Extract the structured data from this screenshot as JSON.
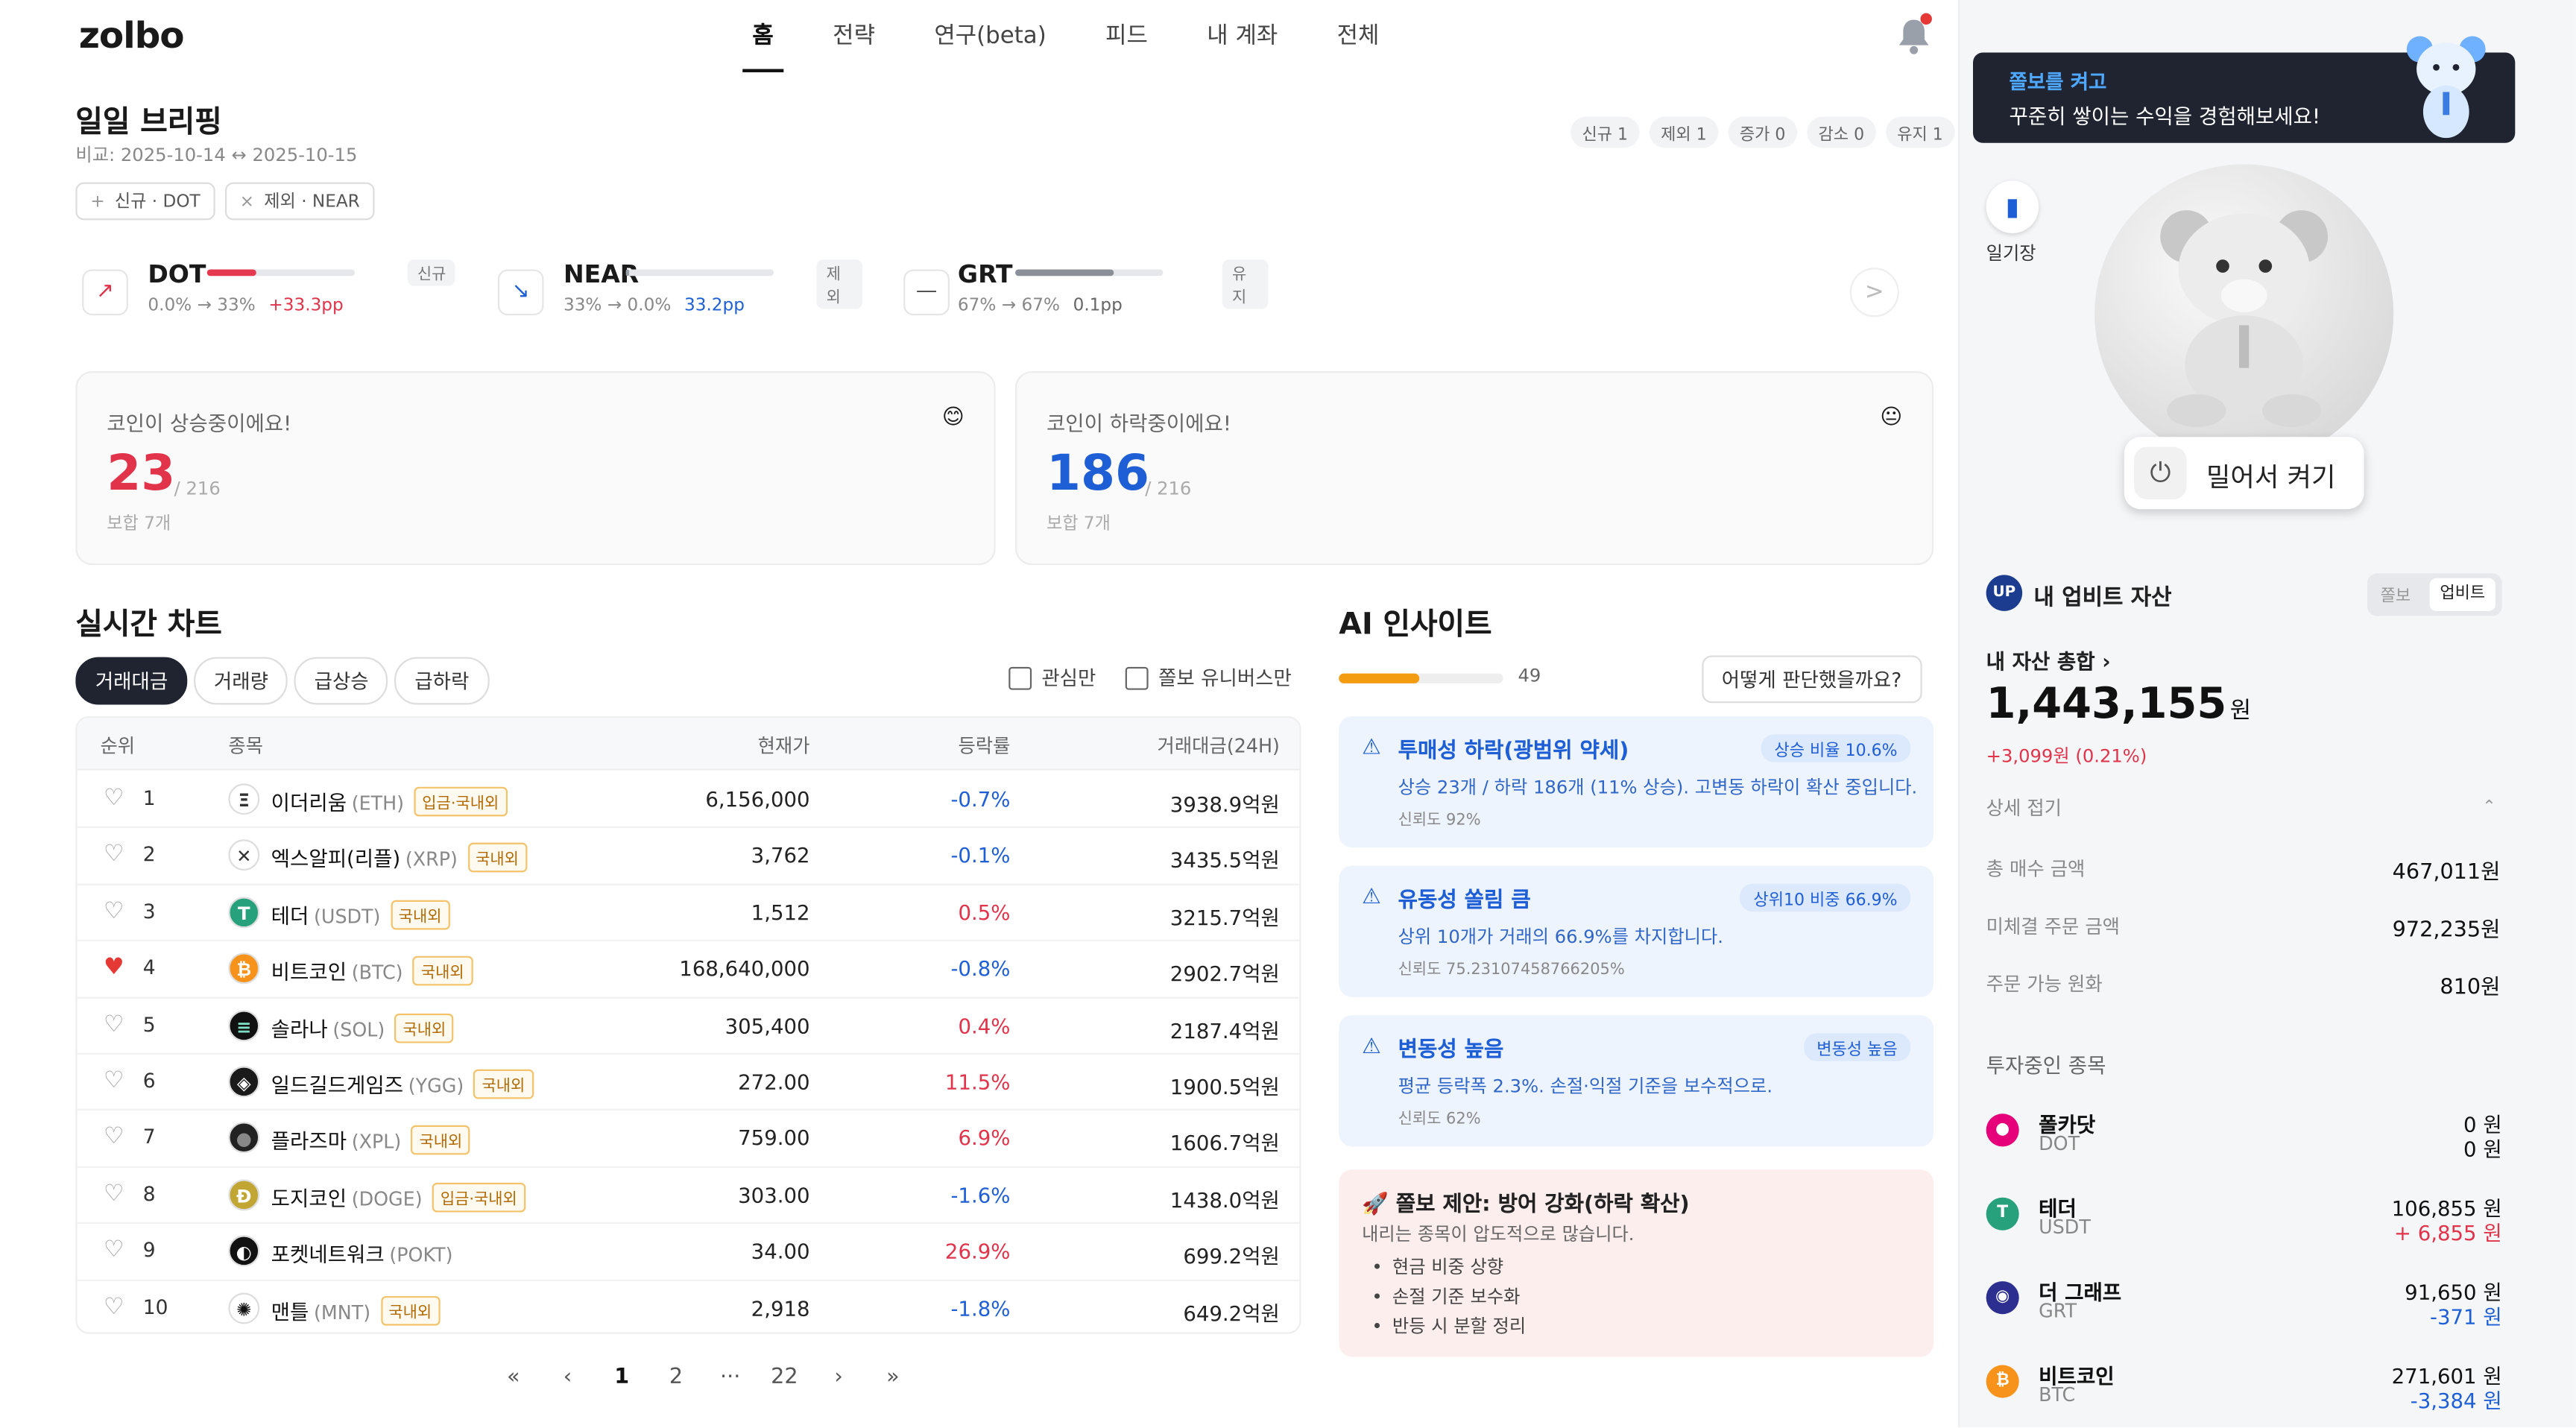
{
  "nav": {
    "logo": "zolbo",
    "items": [
      "홈",
      "전략",
      "연구(beta)",
      "피드",
      "내 계좌",
      "전체"
    ],
    "active": "홈"
  },
  "briefing": {
    "title": "일일 브리핑",
    "compare": "비교: 2025-10-14 ↔ 2025-10-15",
    "chips": [
      {
        "icon": "+",
        "text": "신규 · DOT"
      },
      {
        "icon": "×",
        "text": "제외 · NEAR"
      }
    ],
    "stats": [
      "신규 1",
      "제외 1",
      "증가 0",
      "감소 0",
      "유지 1"
    ],
    "movers": [
      {
        "icon": "↗",
        "name": "DOT",
        "tag": "신규",
        "from": "0.0%",
        "to": "33%",
        "delta": "+33.3pp",
        "bar": 0.33,
        "bar_color": "#e53950",
        "delta_color": "#e1334a"
      },
      {
        "icon": "↘",
        "name": "NEAR",
        "tag": "제외",
        "from": "33%",
        "to": "0.0%",
        "delta": "33.2pp",
        "bar": 0.01,
        "bar_color": "#9aa0aa",
        "delta_color": "#1f5fd6"
      },
      {
        "icon": "—",
        "name": "GRT",
        "tag": "유지",
        "from": "67%",
        "to": "67%",
        "delta": "0.1pp",
        "bar": 0.67,
        "bar_color": "#8a8f98",
        "delta_color": "#666666"
      }
    ],
    "next": ">"
  },
  "cards": {
    "up": {
      "title": "코인이 상승중이에요!",
      "value": "23",
      "total": "/ 216",
      "note": "보합 7개",
      "emoji": "😊"
    },
    "down": {
      "title": "코인이 하락중이에요!",
      "value": "186",
      "total": "/ 216",
      "note": "보합 7개",
      "emoji": "😐"
    }
  },
  "chart": {
    "title": "실시간 차트",
    "tabs": [
      "거래대금",
      "거래량",
      "급상승",
      "급하락"
    ],
    "active_tab": "거래대금",
    "filters": [
      "관심만",
      "쫄보 유니버스만"
    ],
    "columns": [
      "순위",
      "종목",
      "현재가",
      "등락률",
      "거래대금(24H)"
    ],
    "rows": [
      {
        "rank": "1",
        "name": "이더리움",
        "sym": "(ETH)",
        "badge": "입금·국내외",
        "price": "6,156,000",
        "change": "-0.7%",
        "dir": "neg",
        "volume": "3938.9억원",
        "fav": false,
        "logo": "Ξ",
        "logo_bg": "#ffffff",
        "logo_fg": "#333333"
      },
      {
        "rank": "2",
        "name": "엑스알피(리플)",
        "sym": "(XRP)",
        "badge": "국내외",
        "price": "3,762",
        "change": "-0.1%",
        "dir": "neg",
        "volume": "3435.5억원",
        "fav": false,
        "logo": "✕",
        "logo_bg": "#ffffff",
        "logo_fg": "#333333"
      },
      {
        "rank": "3",
        "name": "테더",
        "sym": "(USDT)",
        "badge": "국내외",
        "price": "1,512",
        "change": "0.5%",
        "dir": "pos",
        "volume": "3215.7억원",
        "fav": false,
        "logo": "T",
        "logo_bg": "#26a17b",
        "logo_fg": "#ffffff"
      },
      {
        "rank": "4",
        "name": "비트코인",
        "sym": "(BTC)",
        "badge": "국내외",
        "price": "168,640,000",
        "change": "-0.8%",
        "dir": "neg",
        "volume": "2902.7억원",
        "fav": true,
        "logo": "₿",
        "logo_bg": "#f7931a",
        "logo_fg": "#ffffff"
      },
      {
        "rank": "5",
        "name": "솔라나",
        "sym": "(SOL)",
        "badge": "국내외",
        "price": "305,400",
        "change": "0.4%",
        "dir": "pos",
        "volume": "2187.4억원",
        "fav": false,
        "logo": "≡",
        "logo_bg": "#111111",
        "logo_fg": "#7ee0c4"
      },
      {
        "rank": "6",
        "name": "일드길드게임즈",
        "sym": "(YGG)",
        "badge": "국내외",
        "price": "272.00",
        "change": "11.5%",
        "dir": "pos",
        "volume": "1900.5억원",
        "fav": false,
        "logo": "◈",
        "logo_bg": "#1a1a1a",
        "logo_fg": "#ffffff"
      },
      {
        "rank": "7",
        "name": "플라즈마",
        "sym": "(XPL)",
        "badge": "국내외",
        "price": "759.00",
        "change": "6.9%",
        "dir": "pos",
        "volume": "1606.7억원",
        "fav": false,
        "logo": "●",
        "logo_bg": "#222222",
        "logo_fg": "#888888"
      },
      {
        "rank": "8",
        "name": "도지코인",
        "sym": "(DOGE)",
        "badge": "입금·국내외",
        "price": "303.00",
        "change": "-1.6%",
        "dir": "neg",
        "volume": "1438.0억원",
        "fav": false,
        "logo": "Ð",
        "logo_bg": "#c2a633",
        "logo_fg": "#ffffff"
      },
      {
        "rank": "9",
        "name": "포켓네트워크",
        "sym": "(POKT)",
        "badge": "",
        "price": "34.00",
        "change": "26.9%",
        "dir": "pos",
        "volume": "699.2억원",
        "fav": false,
        "logo": "◐",
        "logo_bg": "#111111",
        "logo_fg": "#ffffff"
      },
      {
        "rank": "10",
        "name": "맨틀",
        "sym": "(MNT)",
        "badge": "국내외",
        "price": "2,918",
        "change": "-1.8%",
        "dir": "neg",
        "volume": "649.2억원",
        "fav": false,
        "logo": "✺",
        "logo_bg": "#ffffff",
        "logo_fg": "#111111"
      }
    ],
    "pager": [
      "«",
      "‹",
      "1",
      "2",
      "···",
      "22",
      "›",
      "»"
    ],
    "current_page": "1"
  },
  "ai": {
    "title": "AI 인사이트",
    "score": "49",
    "score_fraction": 0.49,
    "button": "어떻게 판단했을까요?",
    "insights": [
      {
        "title": "투매성 하락(광범위 약세)",
        "badge": "상승 비율 10.6%",
        "desc": "상승 23개 / 하락 186개 (11% 상승). 고변동 하락이 확산 중입니다.",
        "conf": "신뢰도 92%"
      },
      {
        "title": "유동성 쏠림 큼",
        "badge": "상위10 비중 66.9%",
        "desc": "상위 10개가 거래의 66.9%를 차지합니다.",
        "conf": "신뢰도 75.23107458766205%"
      },
      {
        "title": "변동성 높음",
        "badge": "변동성 높음",
        "desc": "평균 등락폭 2.3%. 손절·익절 기준을 보수적으로.",
        "conf": "신뢰도 62%"
      }
    ],
    "proposal": {
      "title": "🚀 쫄보 제안: 방어 강화(하락 확산)",
      "sub": "내리는 종목이 압도적으로 많습니다.",
      "items": [
        "현금 비중 상향",
        "손절 기준 보수화",
        "반등 시 분할 정리"
      ]
    }
  },
  "side": {
    "banner": {
      "line1": "쫄보를 켜고",
      "line2": "꾸준히 쌓이는 수익을 경험해보세요!"
    },
    "diary": "일기장",
    "push": "밀어서 켜기",
    "asset_title": "내 업비트 자산",
    "seg": [
      "쫄보",
      "업비트"
    ],
    "total_label": "내 자산 총합",
    "total_value": "1,443,155",
    "total_unit": "원",
    "total_delta": "+3,099원 (0.21%)",
    "fold": "상세 접기",
    "kv": [
      {
        "label": "총 매수 금액",
        "value": "467,011원"
      },
      {
        "label": "미체결 주문 금액",
        "value": "972,235원"
      },
      {
        "label": "주문 가능 원화",
        "value": "810원"
      }
    ],
    "holdings_title": "투자중인 종목",
    "holdings": [
      {
        "name": "폴카닷",
        "sym": "DOT",
        "value": "0 원",
        "delta": "0 원",
        "dir": "none",
        "logo": "●",
        "logo_bg": "#e6007a"
      },
      {
        "name": "테더",
        "sym": "USDT",
        "value": "106,855 원",
        "delta": "+ 6,855 원",
        "dir": "pos",
        "logo": "T",
        "logo_bg": "#26a17b"
      },
      {
        "name": "더 그래프",
        "sym": "GRT",
        "value": "91,650 원",
        "delta": "-371 원",
        "dir": "neg",
        "logo": "◉",
        "logo_bg": "#2c2f8f"
      },
      {
        "name": "비트코인",
        "sym": "BTC",
        "value": "271,601 원",
        "delta": "-3,384 원",
        "dir": "neg",
        "logo": "₿",
        "logo_bg": "#f7931a"
      }
    ]
  }
}
